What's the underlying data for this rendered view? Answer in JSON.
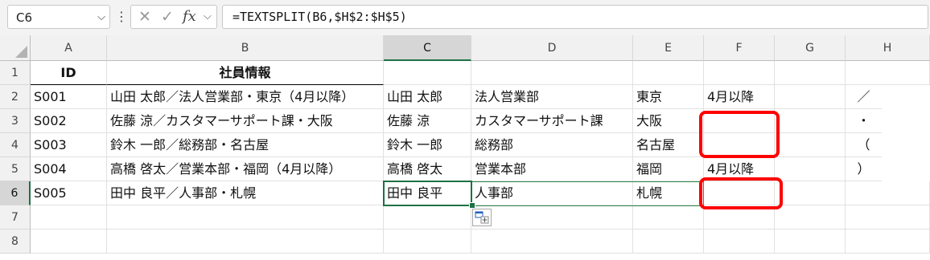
{
  "formula_bar": {
    "name_box": "C6",
    "formula": "=TEXTSPLIT(B6,$H$2:$H$5)",
    "fx_label": "fx"
  },
  "columns": [
    "A",
    "B",
    "C",
    "D",
    "E",
    "F",
    "G",
    "H"
  ],
  "rows": [
    "1",
    "2",
    "3",
    "4",
    "5",
    "6",
    "7",
    "8"
  ],
  "header": {
    "id": "ID",
    "info": "社員情報"
  },
  "data_rows": [
    {
      "a": "S001",
      "b": "山田 太郎／法人営業部・東京（4月以降）",
      "c": "山田 太郎",
      "d": "法人営業部",
      "e": "東京",
      "f": "4月以降",
      "h": "／"
    },
    {
      "a": "S002",
      "b": "佐藤 涼／カスタマーサポート課・大阪",
      "c": "佐藤 涼",
      "d": "カスタマーサポート課",
      "e": "大阪",
      "f": "",
      "h": "・"
    },
    {
      "a": "S003",
      "b": "鈴木 一郎／総務部・名古屋",
      "c": "鈴木 一郎",
      "d": "総務部",
      "e": "名古屋",
      "f": "",
      "h": "（"
    },
    {
      "a": "S004",
      "b": "高橋 啓太／営業本部・福岡（4月以降）",
      "c": "高橋 啓太",
      "d": "営業本部",
      "e": "福岡",
      "f": "4月以降",
      "h": "）"
    },
    {
      "a": "S005",
      "b": "田中 良平／人事部・札幌",
      "c": "田中 良平",
      "d": "人事部",
      "e": "札幌",
      "f": "",
      "h": ""
    }
  ],
  "colors": {
    "highlight": "#ff0000",
    "selection": "#1e7145"
  }
}
